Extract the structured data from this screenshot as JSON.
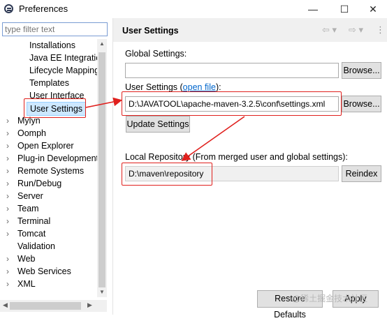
{
  "window": {
    "title": "Preferences",
    "minimize_glyph": "—",
    "maximize_glyph": "☐",
    "close_glyph": "✕"
  },
  "sidebar": {
    "filter_placeholder": "type filter text",
    "items": [
      {
        "label": "Installations",
        "indent": 2,
        "expandable": false
      },
      {
        "label": "Java EE Integratio",
        "indent": 2,
        "expandable": false
      },
      {
        "label": "Lifecycle Mapping",
        "indent": 2,
        "expandable": false
      },
      {
        "label": "Templates",
        "indent": 2,
        "expandable": false
      },
      {
        "label": "User Interface",
        "indent": 2,
        "expandable": false
      },
      {
        "label": "User Settings",
        "indent": 2,
        "expandable": false,
        "selected": true
      },
      {
        "label": "Mylyn",
        "indent": 1,
        "expandable": true
      },
      {
        "label": "Oomph",
        "indent": 1,
        "expandable": true
      },
      {
        "label": "Open Explorer",
        "indent": 1,
        "expandable": true
      },
      {
        "label": "Plug-in Development",
        "indent": 1,
        "expandable": true
      },
      {
        "label": "Remote Systems",
        "indent": 1,
        "expandable": true
      },
      {
        "label": "Run/Debug",
        "indent": 1,
        "expandable": true
      },
      {
        "label": "Server",
        "indent": 1,
        "expandable": true
      },
      {
        "label": "Team",
        "indent": 1,
        "expandable": true
      },
      {
        "label": "Terminal",
        "indent": 1,
        "expandable": true
      },
      {
        "label": "Tomcat",
        "indent": 1,
        "expandable": true
      },
      {
        "label": "Validation",
        "indent": 1,
        "expandable": false
      },
      {
        "label": "Web",
        "indent": 1,
        "expandable": true
      },
      {
        "label": "Web Services",
        "indent": 1,
        "expandable": true
      },
      {
        "label": "XML",
        "indent": 1,
        "expandable": true
      }
    ]
  },
  "page": {
    "title": "User Settings",
    "nav_back_glyph": "⇦ ▾",
    "nav_forward_glyph": "⇨ ▾",
    "nav_menu_glyph": "⋮",
    "global_settings_label": "Global Settings:",
    "global_settings_value": "",
    "browse_label": "Browse...",
    "user_settings_label": "User Settings (",
    "user_settings_link": "open file",
    "user_settings_label_end": "):",
    "user_settings_value": "D:\\JAVATOOL\\apache-maven-3.2.5\\conf\\settings.xml",
    "browse2_label": "Browse...",
    "update_label": "Update Settings",
    "local_repo_label": "Local Repository (From merged user and global settings):",
    "local_repo_value": "D:\\maven\\repository",
    "reindex_label": "Reindex",
    "restore_label": "Restore Defaults",
    "apply_label": "Apply"
  },
  "watermark": "@稀土掘金技术社区",
  "colors": {
    "annotation_red": "#e0201d",
    "selection": "#cde8ff",
    "link": "#0066cc"
  }
}
